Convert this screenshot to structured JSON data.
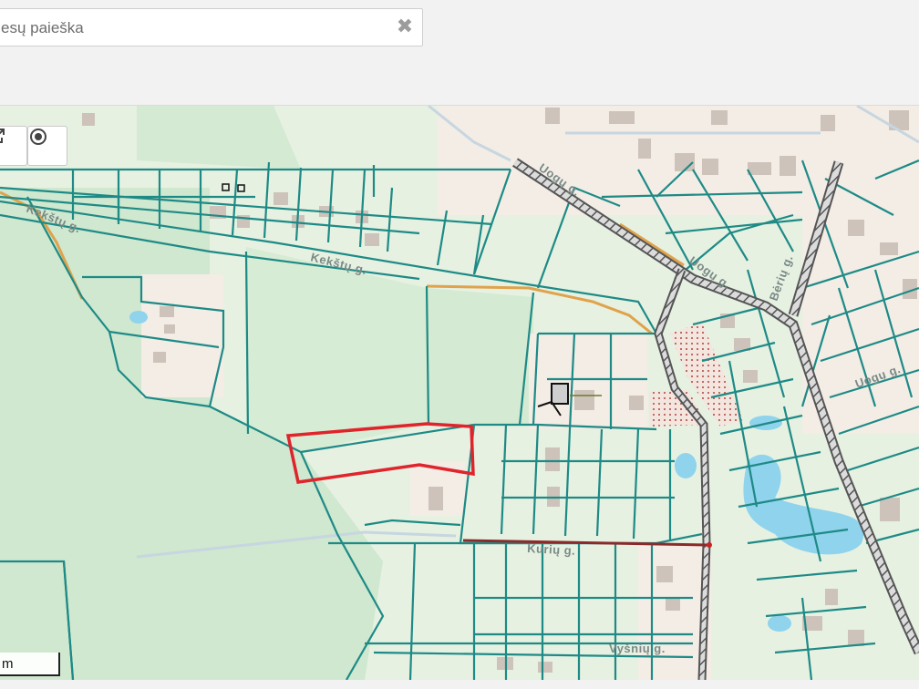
{
  "search": {
    "value": "esų paieška",
    "clear_icon": "close-icon",
    "clear_glyph": "✖"
  },
  "map_tools": [
    {
      "name": "share-button",
      "icon": "share-icon"
    },
    {
      "name": "locate-button",
      "icon": "target-icon"
    }
  ],
  "streets": {
    "kekstu_1": "Kekštų g.",
    "kekstu_2": "Kekštų g.",
    "uogu_1": "Uogų g.",
    "uogu_2": "Uogų g.",
    "uogu_3": "Uogų g.",
    "beriu": "Bėrių g.",
    "kuriu": "Kurių g.",
    "vysniu": "Vyšnių g."
  },
  "scale_bar": {
    "label": "m"
  },
  "colors": {
    "parcel_line": "#1e8a86",
    "highlight_parcel": "#e0242c",
    "forest": "#cfe8cf",
    "built_area": "#f3ede6",
    "water": "#8fd3ec",
    "road_hatch": "#555555",
    "path_orange": "#e0a24a"
  }
}
